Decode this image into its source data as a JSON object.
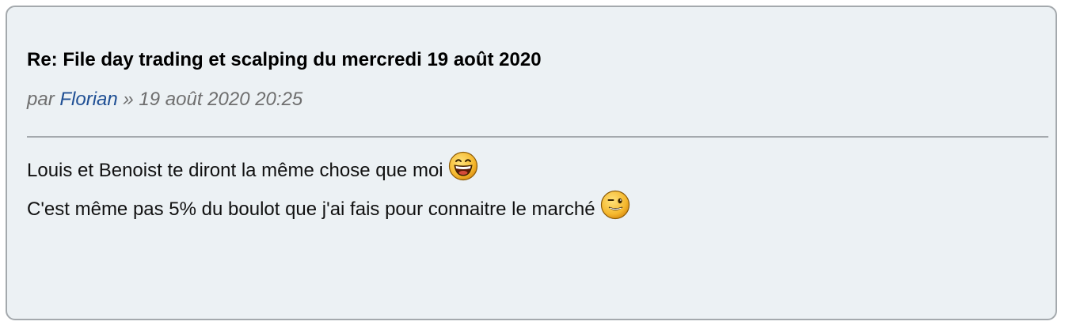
{
  "post": {
    "title": "Re: File day trading et scalping du mercredi 19 août 2020",
    "meta": {
      "by_label": "par ",
      "author": "Florian",
      "separator": " » ",
      "date": "19 août 2020 20:25"
    },
    "content": {
      "lines": [
        {
          "text": "Louis et Benoist te diront la même chose que moi ",
          "smiley": "laughing-smiley-icon"
        },
        {
          "text": "C'est même pas 5% du boulot que j'ai fais pour connaitre le marché ",
          "smiley": "wink-smiley-icon"
        }
      ]
    }
  },
  "colors": {
    "background": "#ecf1f4",
    "border": "#a4a9ad",
    "author_link": "#1f4f94",
    "meta_text": "#6f6f6f"
  }
}
